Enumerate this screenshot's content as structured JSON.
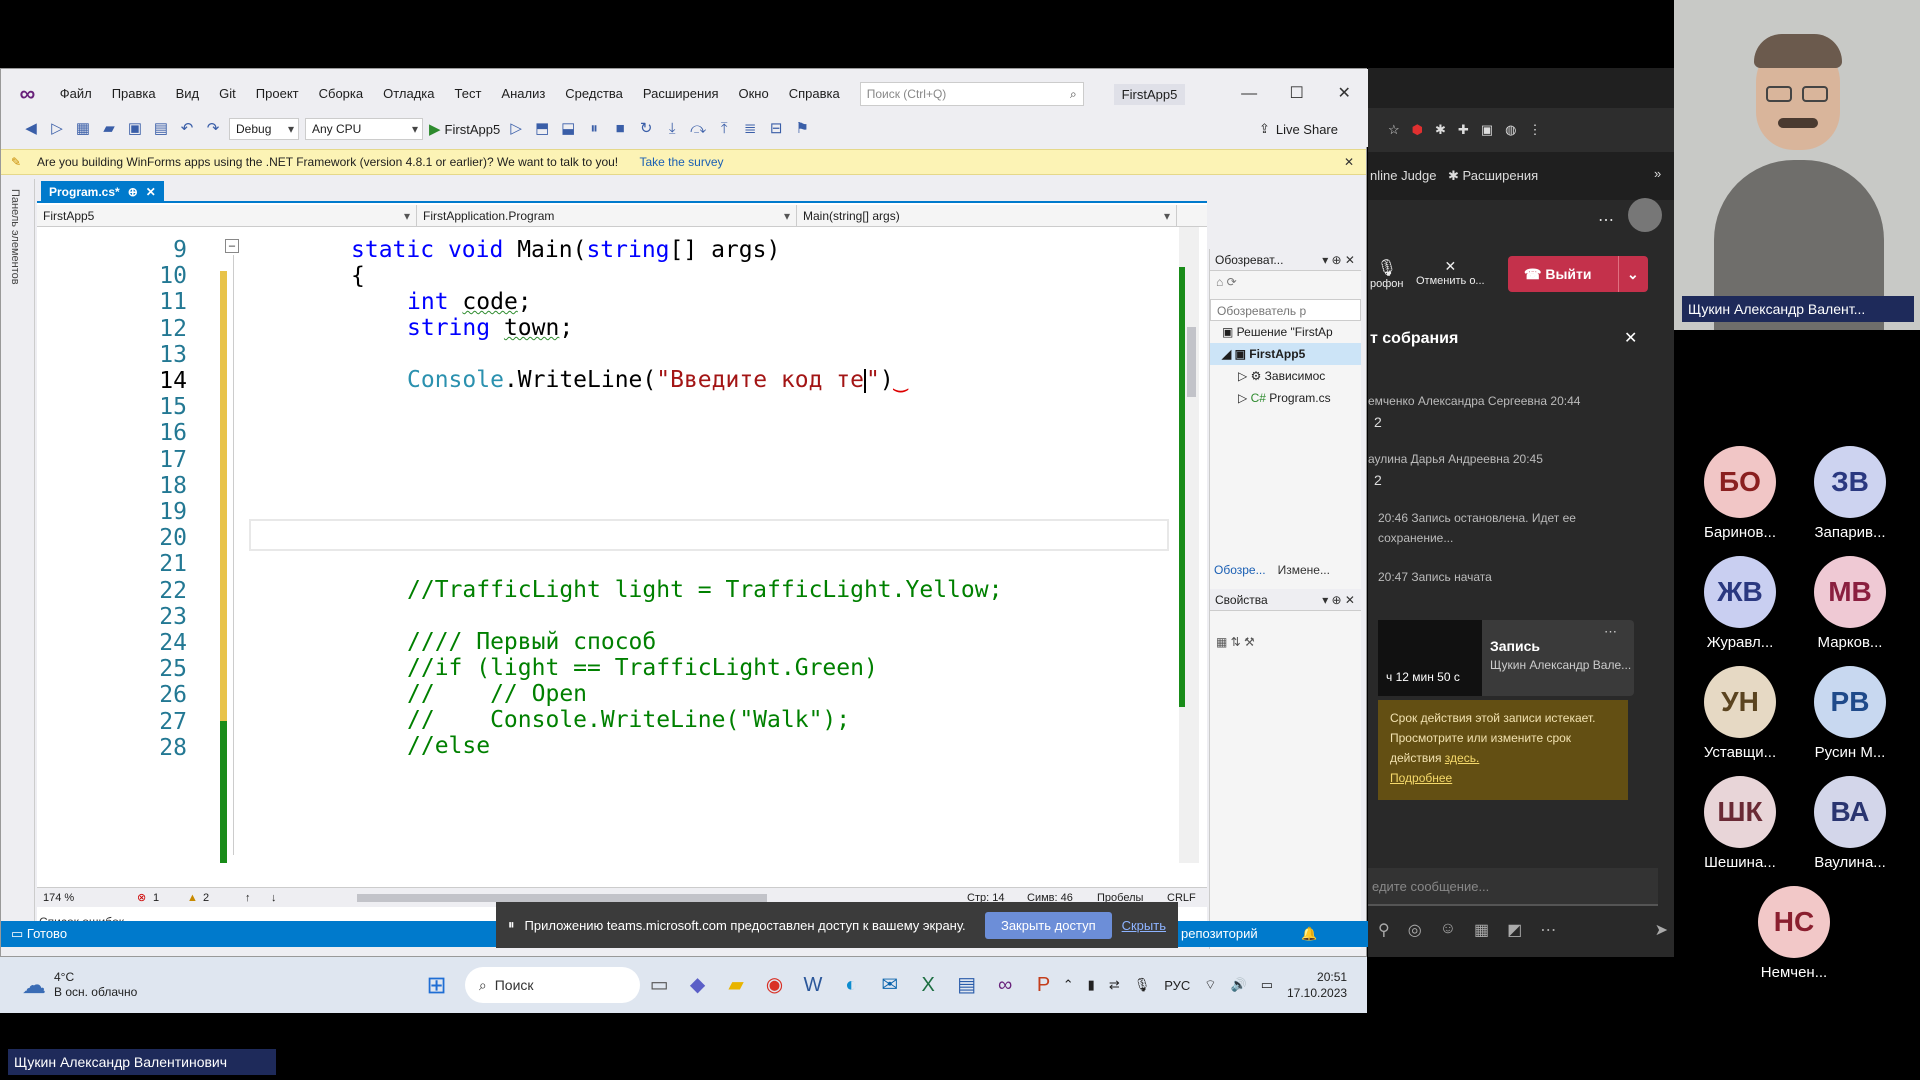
{
  "vs": {
    "menu": [
      "Файл",
      "Правка",
      "Вид",
      "Git",
      "Проект",
      "Сборка",
      "Отладка",
      "Тест",
      "Анализ",
      "Средства",
      "Расширения",
      "Окно",
      "Справка"
    ],
    "search_placeholder": "Поиск (Ctrl+Q)",
    "solution_name": "FirstApp5",
    "toolbar": {
      "config": "Debug",
      "platform": "Any CPU",
      "run_target": "FirstApp5",
      "live_share": "Live Share"
    },
    "infobar": {
      "message": "Are you building WinForms apps using the .NET Framework (version 4.8.1 or earlier)? We want to talk to you!",
      "link": "Take the survey"
    },
    "side_strip_label": "Панель элементов",
    "tab": {
      "name": "Program.cs*",
      "pin": "⊕",
      "close": "✕"
    },
    "nav": {
      "project": "FirstApp5",
      "class": "FirstApplication.Program",
      "member": "Main(string[] args)"
    },
    "code": {
      "line_numbers": [
        "9",
        "10",
        "11",
        "12",
        "13",
        "14",
        "15",
        "16",
        "17",
        "18",
        "19",
        "20",
        "21",
        "22",
        "23",
        "24",
        "25",
        "26",
        "27",
        "28"
      ],
      "current_line": "14"
    },
    "editor_status": {
      "zoom": "174 %",
      "errors": "1",
      "warnings": "2",
      "line": "Стр: 14",
      "col": "Симв: 46",
      "spaces": "Пробелы",
      "eol": "CRLF"
    },
    "error_list": "Список ошибок",
    "solution_pane": {
      "title": "Обозреват...",
      "search": "Обозреватель р",
      "items": [
        "Решение \"FirstAp",
        "FirstApp5",
        "Зависимос",
        "Program.cs"
      ],
      "tabs": [
        "Обозре...",
        "Измене..."
      ]
    },
    "properties_pane": {
      "title": "Свойства"
    },
    "status": {
      "ready": "Готово",
      "repo": "репозиторий"
    }
  },
  "share_banner": {
    "message": "Приложению teams.microsoft.com предоставлен доступ к вашему экрану.",
    "stop": "Закрыть доступ",
    "hide": "Скрыть"
  },
  "taskbar": {
    "weather_temp": "4°C",
    "weather_desc": "В осн. облачно",
    "search": "Поиск",
    "lang": "РУС",
    "time": "20:51",
    "date": "17.10.2023"
  },
  "teams": {
    "browser_bar": {
      "judge": "nline Judge",
      "ext": "Расширения"
    },
    "controls": {
      "mic": "рофон",
      "cancel": "Отменить о...",
      "leave": "Выйти"
    },
    "chat_title": "т собрания",
    "messages": [
      {
        "author": "емченко Александра Сергеевна",
        "time": "20:44",
        "text": "2"
      },
      {
        "author": "аулина Дарья Андреевна",
        "time": "20:45",
        "text": "2"
      },
      {
        "time": "20:46",
        "text": "Запись остановлена. Идет ее сохранение..."
      },
      {
        "time": "20:47",
        "text": "Запись начата"
      }
    ],
    "recording": {
      "title": "Запись",
      "by": "Щукин Александр Вале...",
      "duration": "ч 12 мин 50 с"
    },
    "rec_warning": {
      "text": "Срок действия этой записи истекает. Просмотрите или измените срок действия",
      "link": "здесь.",
      "more": "Подробнее"
    },
    "compose_placeholder": "едите сообщение..."
  },
  "participants": {
    "video_name": "Щукин Александр Валент...",
    "tiles": [
      {
        "initials": "БО",
        "name": "Баринов...",
        "bg": "#f1c6c6",
        "fg": "#8a1f1f"
      },
      {
        "initials": "ЗВ",
        "name": "Запарив...",
        "bg": "#cdd3f0",
        "fg": "#2a3880"
      },
      {
        "initials": "ЖВ",
        "name": "Журавл...",
        "bg": "#c9cff1",
        "fg": "#2a3880"
      },
      {
        "initials": "МВ",
        "name": "Марков...",
        "bg": "#efc9d4",
        "fg": "#8a1f3f"
      },
      {
        "initials": "УН",
        "name": "Уставщи...",
        "bg": "#e6d9c4",
        "fg": "#5b4420"
      },
      {
        "initials": "РВ",
        "name": "Русин М...",
        "bg": "#c8d8f0",
        "fg": "#1f4a8a"
      },
      {
        "initials": "ШК",
        "name": "Шешина...",
        "bg": "#e8d5d8",
        "fg": "#6a2a35"
      },
      {
        "initials": "ВА",
        "name": "Ваулина...",
        "bg": "#d3d6ea",
        "fg": "#2a3570"
      },
      {
        "initials": "НС",
        "name": "Немчен...",
        "bg": "#f2c8c8",
        "fg": "#8a1f2f"
      }
    ]
  },
  "presenter_label": "Щукин Александр Валентинович",
  "colors": {
    "vs_accent": "#007acc",
    "teams_leave": "#c4314b",
    "code_keyword": "#0000ff",
    "code_string": "#a31515",
    "code_comment": "#008000"
  }
}
